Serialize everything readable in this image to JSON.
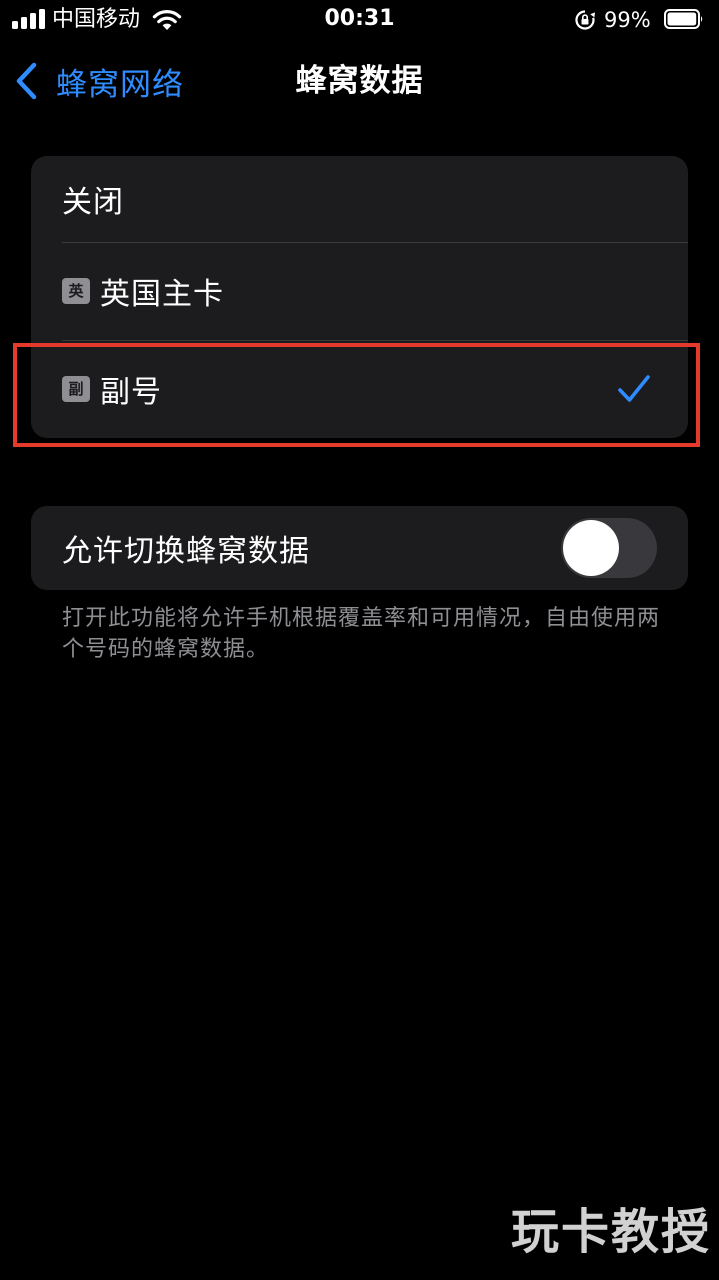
{
  "status_bar": {
    "carrier": "中国移动",
    "time": "00:31",
    "battery_percent": "99%",
    "battery_level": 0.99
  },
  "nav": {
    "back_label": "蜂窝网络",
    "title": "蜂窝数据"
  },
  "options": {
    "items": [
      {
        "label": "关闭",
        "badge": "",
        "selected": false
      },
      {
        "label": "英国主卡",
        "badge": "英",
        "selected": false
      },
      {
        "label": "副号",
        "badge": "副",
        "selected": true
      }
    ]
  },
  "switch_setting": {
    "label": "允许切换蜂窝数据",
    "enabled": false
  },
  "footnote": "打开此功能将允许手机根据覆盖率和可用情况，自由使用两个号码的蜂窝数据。",
  "watermark": "玩卡教授",
  "colors": {
    "accent": "#2f8cff",
    "highlight": "#e43a2c",
    "cell_background": "#1c1c1e"
  }
}
